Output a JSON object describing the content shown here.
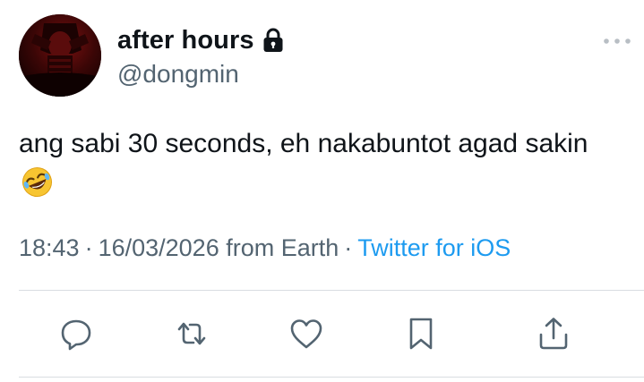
{
  "author": {
    "display_name": "after hours",
    "handle": "@dongmin",
    "avatar_icon": "profile-photo",
    "protected_icon": "lock-icon"
  },
  "more_icon": "more-dots-icon",
  "tweet": {
    "text": "ang sabi 30 seconds, eh nakabuntot agad sakin",
    "emoji": "rolling-on-floor-laughing-emoji"
  },
  "meta": {
    "time": "18:43",
    "separator": "·",
    "date": "16/03/2026",
    "location": "from Earth",
    "source": "Twitter for iOS"
  },
  "actions": [
    {
      "icon": "reply-icon"
    },
    {
      "icon": "retweet-icon"
    },
    {
      "icon": "like-icon"
    },
    {
      "icon": "bookmark-icon"
    },
    {
      "icon": "share-icon"
    }
  ],
  "colors": {
    "text": "#0f1419",
    "secondary": "#536471",
    "accent": "#1d9bf0",
    "divider": "#d9dde1"
  }
}
